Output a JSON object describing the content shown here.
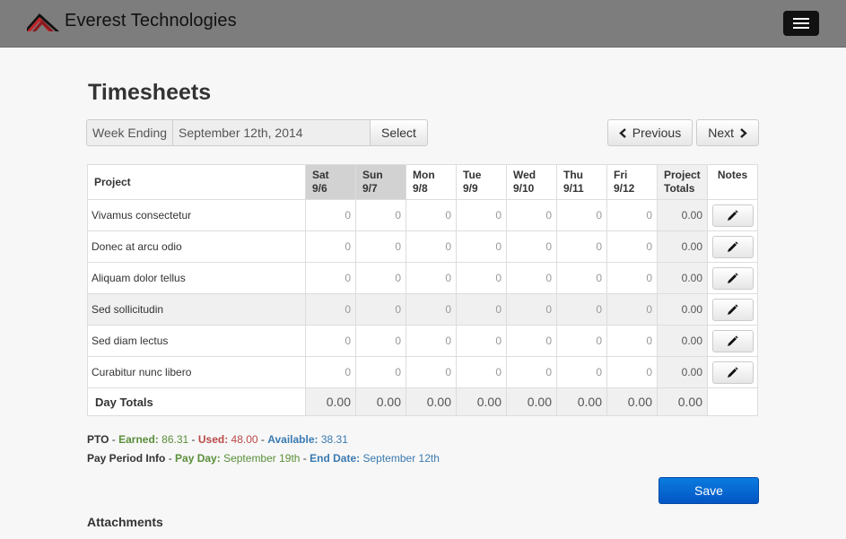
{
  "brand": {
    "name": "Everest Technologies"
  },
  "page": {
    "title": "Timesheets"
  },
  "week": {
    "label": "Week Ending",
    "value": "September 12th, 2014",
    "select_label": "Select"
  },
  "nav": {
    "previous_label": "Previous",
    "next_label": "Next"
  },
  "table": {
    "project_header": "Project",
    "days": [
      {
        "name": "Sat",
        "date": "9/6",
        "weekend": true
      },
      {
        "name": "Sun",
        "date": "9/7",
        "weekend": true
      },
      {
        "name": "Mon",
        "date": "9/8",
        "weekend": false
      },
      {
        "name": "Tue",
        "date": "9/9",
        "weekend": false
      },
      {
        "name": "Wed",
        "date": "9/10",
        "weekend": false
      },
      {
        "name": "Thu",
        "date": "9/11",
        "weekend": false
      },
      {
        "name": "Fri",
        "date": "9/12",
        "weekend": false
      }
    ],
    "project_totals_header_1": "Project",
    "project_totals_header_2": "Totals",
    "notes_header": "Notes",
    "rows": [
      {
        "project": "Vivamus consectetur",
        "hours": [
          "0",
          "0",
          "0",
          "0",
          "0",
          "0",
          "0"
        ],
        "total": "0.00",
        "shaded": false
      },
      {
        "project": "Donec at arcu odio",
        "hours": [
          "0",
          "0",
          "0",
          "0",
          "0",
          "0",
          "0"
        ],
        "total": "0.00",
        "shaded": false
      },
      {
        "project": "Aliquam dolor tellus",
        "hours": [
          "0",
          "0",
          "0",
          "0",
          "0",
          "0",
          "0"
        ],
        "total": "0.00",
        "shaded": false
      },
      {
        "project": "Sed sollicitudin",
        "hours": [
          "0",
          "0",
          "0",
          "0",
          "0",
          "0",
          "0"
        ],
        "total": "0.00",
        "shaded": true
      },
      {
        "project": "Sed diam lectus",
        "hours": [
          "0",
          "0",
          "0",
          "0",
          "0",
          "0",
          "0"
        ],
        "total": "0.00",
        "shaded": false
      },
      {
        "project": "Curabitur nunc libero",
        "hours": [
          "0",
          "0",
          "0",
          "0",
          "0",
          "0",
          "0"
        ],
        "total": "0.00",
        "shaded": false
      }
    ],
    "day_totals_label": "Day Totals",
    "day_totals": [
      "0.00",
      "0.00",
      "0.00",
      "0.00",
      "0.00",
      "0.00",
      "0.00",
      "0.00"
    ]
  },
  "pto": {
    "label": "PTO",
    "earned_label": "Earned:",
    "earned": "86.31",
    "used_label": "Used:",
    "used": "48.00",
    "available_label": "Available:",
    "available": "38.31"
  },
  "pay_period": {
    "label": "Pay Period Info",
    "pay_day_label": "Pay Day:",
    "pay_day": "September 19th",
    "end_date_label": "End Date:",
    "end_date": "September 12th"
  },
  "actions": {
    "save_label": "Save"
  },
  "attachments": {
    "title": "Attachments"
  },
  "icons": {
    "menu": "hamburger-menu-icon",
    "previous": "chevron-left-icon",
    "next": "chevron-right-icon",
    "note": "pencil-icon",
    "logo": "mountain-logo-icon"
  },
  "colors": {
    "navbar": "#7d7d7d",
    "save": "#0a6ad6",
    "earned": "#5a8f3a",
    "used": "#b94a48",
    "available": "#3a7ab0"
  }
}
